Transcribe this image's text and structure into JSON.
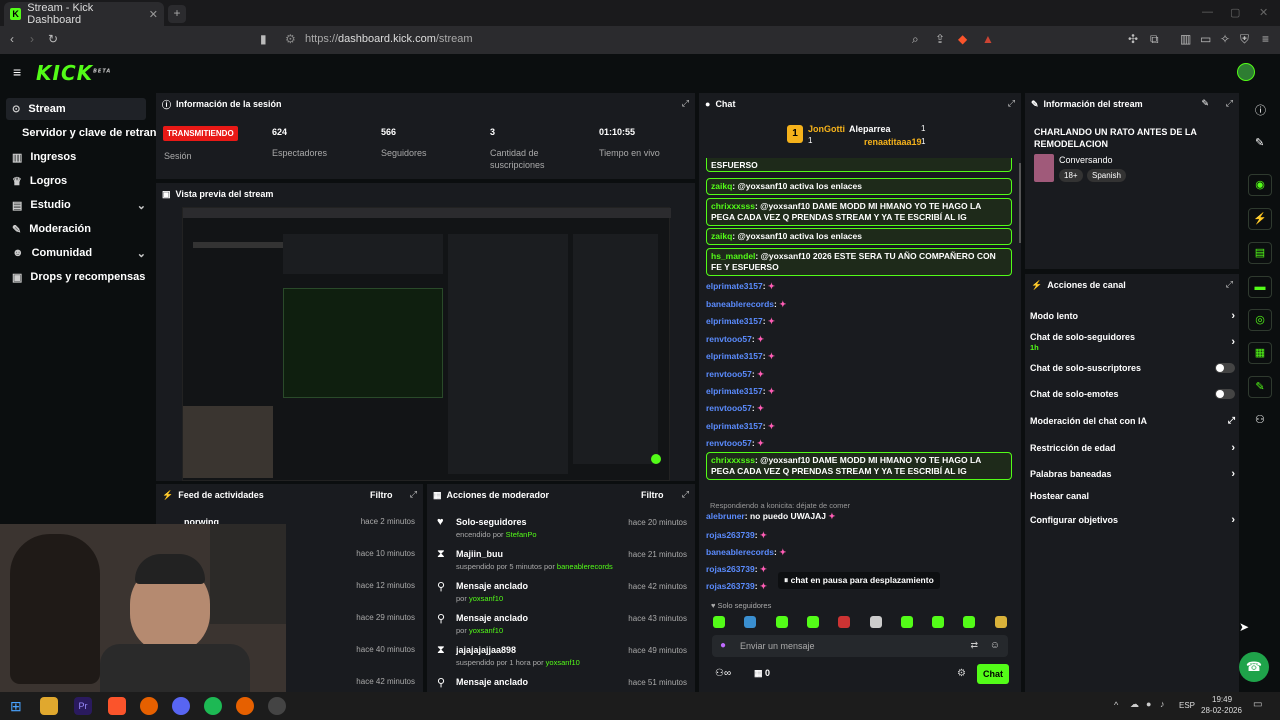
{
  "browser": {
    "tab_title": "Stream - Kick Dashboard",
    "url_prefix": "https://",
    "url_host": "dashboard.kick.com",
    "url_path": "/stream"
  },
  "header": {
    "logo": "KICK",
    "logo_beta": "BETA"
  },
  "sidebar": {
    "items": [
      {
        "label": "Stream",
        "icon": "broadcast-icon"
      },
      {
        "label": "Servidor y clave de retransmisión",
        "icon": ""
      },
      {
        "label": "Ingresos",
        "icon": "bars-icon"
      },
      {
        "label": "Logros",
        "icon": "trophy-icon"
      },
      {
        "label": "Estudio",
        "icon": "book-icon"
      },
      {
        "label": "Moderación",
        "icon": "wrench-icon"
      },
      {
        "label": "Comunidad",
        "icon": "people-icon"
      },
      {
        "label": "Drops y recompensas",
        "icon": "gift-icon"
      }
    ]
  },
  "session": {
    "title": "Información de la sesión",
    "status": "TRANSMITIENDO",
    "status_label": "Sesión",
    "stats": [
      {
        "value": "624",
        "label": "Espectadores"
      },
      {
        "value": "566",
        "label": "Seguidores"
      },
      {
        "value": "3",
        "label": "Cantidad de suscripciones"
      },
      {
        "value": "01:10:55",
        "label": "Tiempo en vivo"
      }
    ]
  },
  "preview": {
    "title": "Vista previa del stream"
  },
  "activity": {
    "title": "Feed de actividades",
    "filter": "Filtro",
    "items": [
      {
        "name": "norwing",
        "time": "hace 2 minutos"
      },
      {
        "name": "",
        "time": "hace 10 minutos"
      },
      {
        "name": "",
        "time": "hace 12 minutos"
      },
      {
        "name": "",
        "time": "hace 29 minutos"
      },
      {
        "name": "",
        "time": "hace 40 minutos"
      },
      {
        "name": "",
        "time": "hace 42 minutos"
      }
    ]
  },
  "modactions": {
    "title": "Acciones de moderador",
    "filter": "Filtro",
    "items": [
      {
        "title": "Solo-seguidores",
        "sub": "encendido por",
        "by": "StefanPo",
        "time": "hace 20 minutos",
        "icon": "heart-icon"
      },
      {
        "title": "Majiin_buu",
        "sub": "suspendido por 5 minutos por",
        "by": "baneablerecords",
        "time": "hace 21 minutos",
        "icon": "hourglass-icon"
      },
      {
        "title": "Mensaje anclado",
        "sub": "por",
        "by": "yoxsanf10",
        "time": "hace 42 minutos",
        "icon": "pin-icon"
      },
      {
        "title": "Mensaje anclado",
        "sub": "por",
        "by": "yoxsanf10",
        "time": "hace 43 minutos",
        "icon": "pin-icon"
      },
      {
        "title": "jajajajajjaa898",
        "sub": "suspendido por 1 hora por",
        "by": "yoxsanf10",
        "time": "hace 49 minutos",
        "icon": "hourglass-icon"
      },
      {
        "title": "Mensaje anclado",
        "sub": "",
        "by": "",
        "time": "hace 51 minutos",
        "icon": "pin-icon"
      }
    ]
  },
  "chat": {
    "title": "Chat",
    "top_gifters": [
      {
        "name": "JonGotti",
        "count": "1"
      },
      {
        "name": "Aleparrea",
        "count": "1"
      },
      {
        "name": "renaatitaaa19",
        "count": "1"
      }
    ],
    "messages": [
      {
        "user": "",
        "text": "ESFUERSO",
        "hl": true
      },
      {
        "user": "zaikq",
        "text": "@yoxsanf10 activa los enlaces",
        "hl": true
      },
      {
        "user": "chrixxxsss",
        "text": "@yoxsanf10 DAME MODD MI HMANO YO TE HAGO LA PEGA CADA VEZ Q PRENDAS STREAM Y YA TE ESCRIBÍ AL IG",
        "hl": true
      },
      {
        "user": "zaikq",
        "text": "@yoxsanf10 activa los enlaces",
        "hl": true
      },
      {
        "user": "hs_mandel",
        "text": "@yoxsanf10 2026 ESTE SERA TU AÑO COMPAÑERO CON FE Y ESFUERSO",
        "hl": true
      },
      {
        "user": "elprimate3157",
        "text": "",
        "hl": false
      },
      {
        "user": "baneablerecords",
        "text": "",
        "hl": false
      },
      {
        "user": "elprimate3157",
        "text": "",
        "hl": false
      },
      {
        "user": "renvtooo57",
        "text": "",
        "hl": false
      },
      {
        "user": "elprimate3157",
        "text": "",
        "hl": false
      },
      {
        "user": "renvtooo57",
        "text": "",
        "hl": false
      },
      {
        "user": "elprimate3157",
        "text": "",
        "hl": false
      },
      {
        "user": "renvtooo57",
        "text": "",
        "hl": false
      },
      {
        "user": "elprimate3157",
        "text": "",
        "hl": false
      },
      {
        "user": "renvtooo57",
        "text": "",
        "hl": false
      },
      {
        "user": "chrixxxsss",
        "text": "@yoxsanf10 DAME MODD MI HMANO YO TE HAGO LA PEGA CADA VEZ Q PRENDAS STREAM Y YA TE ESCRIBÍ AL IG",
        "hl": true
      }
    ],
    "reply_to": "Respondiendo a konicita: déjate de comer",
    "late_messages": [
      {
        "user": "alebruner",
        "text": "no puedo UWAJAJ"
      },
      {
        "user": "rojas263739",
        "text": ""
      },
      {
        "user": "baneablerecords",
        "text": ""
      },
      {
        "user": "rojas263739",
        "text": ""
      },
      {
        "user": "rojas263739",
        "text": ""
      }
    ],
    "paused": "chat en pausa para desplazamiento",
    "mode": "Solo seguidores",
    "input_placeholder": "Enviar un mensaje",
    "count": "0",
    "send_label": "Chat"
  },
  "stream_info": {
    "title": "Información del stream",
    "stream_title": "CHARLANDO UN RATO ANTES DE LA REMODELACION",
    "category": "Conversando",
    "tags": [
      "18+",
      "Spanish"
    ]
  },
  "channel_actions": {
    "title": "Acciones de canal",
    "items": [
      {
        "label": "Modo lento",
        "sub": "",
        "control": "arrow"
      },
      {
        "label": "Chat de solo-seguidores",
        "sub": "1h",
        "control": "arrow"
      },
      {
        "label": "Chat de solo-suscriptores",
        "sub": "",
        "control": "toggle"
      },
      {
        "label": "Chat de solo-emotes",
        "sub": "",
        "control": "toggle"
      },
      {
        "label": "Moderación del chat con IA",
        "sub": "",
        "control": "external"
      },
      {
        "label": "Restricción de edad",
        "sub": "",
        "control": "arrow"
      },
      {
        "label": "Palabras baneadas",
        "sub": "",
        "control": "arrow"
      },
      {
        "label": "Hostear canal",
        "sub": "",
        "control": ""
      },
      {
        "label": "Configurar objetivos",
        "sub": "",
        "control": "arrow"
      }
    ]
  },
  "taskbar": {
    "lang": "ESP",
    "time": "19:49",
    "date": "28-02-2026"
  },
  "colors": {
    "accent": "#53fc18",
    "live": "#e91916",
    "panel": "#191b1f",
    "bg": "#0b0e0f"
  }
}
